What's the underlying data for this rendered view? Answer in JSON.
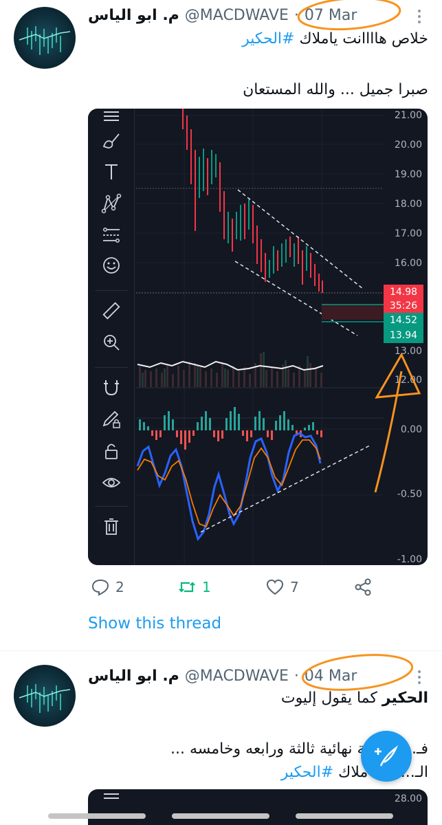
{
  "tweets": [
    {
      "name": "م. ابو الياس",
      "handle": "@MACDWAVE",
      "date": "07 Mar",
      "text_line1_prefix": "خلاص هاااانت ياملاك ",
      "text_line1_hashtag": "#الحكير",
      "text_line2": "صبرا جميل ... والله المستعان",
      "actions": {
        "replies": "2",
        "retweets": "1",
        "likes": "7"
      },
      "show_thread": "Show this thread"
    },
    {
      "name": "م. ابو الياس",
      "handle": "@MACDWAVE",
      "date": "04 Mar",
      "text_line1_bold": "الحكير",
      "text_line1_rest": " كما يقول إليوت",
      "text_line2": "فـ... قطرية نهائية ثالثة ورابعه وخامسه ...",
      "text_line3_prefix": "الـ...ب يا ملاك ",
      "text_line3_hashtag": "#الحكير"
    }
  ],
  "chart": {
    "price_labels": [
      "21.00",
      "20.00",
      "19.00",
      "18.00",
      "17.00",
      "16.00",
      "13.00",
      "12.00",
      "0.00",
      "-0.50",
      "-1.00"
    ],
    "badges": [
      {
        "text": "14.98",
        "color": "#f23645"
      },
      {
        "text": "35:26",
        "color": "#f23645"
      },
      {
        "text": "14.52",
        "color": "#089981"
      },
      {
        "text": "13.94",
        "color": "#089981"
      }
    ],
    "tools": [
      "menu-icon",
      "brush-icon",
      "text-icon",
      "pattern-icon",
      "measure-lines-icon",
      "emoji-icon",
      "ruler-icon",
      "zoom-in-icon",
      "magnet-icon",
      "pencil-lock-icon",
      "lock-icon",
      "eye-icon",
      "trash-icon"
    ]
  },
  "chart2": {
    "price_label": "28.00"
  },
  "colors": {
    "accent": "#1d9bf0",
    "retweet": "#00ba7c",
    "annotation": "#f7931e",
    "chart_bg": "#131722"
  }
}
